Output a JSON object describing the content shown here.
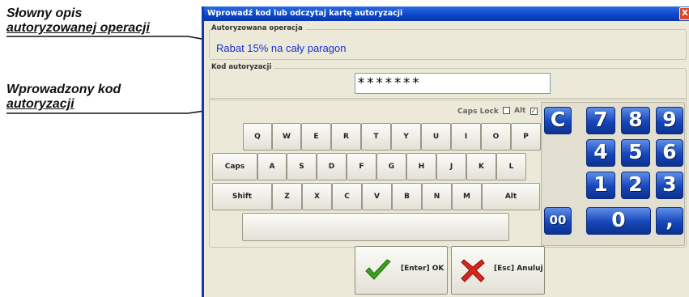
{
  "annotations": {
    "op_line1": "Słowny opis",
    "op_line2": "autoryzowanej operacji",
    "code_line1": "Wprowadzony kod",
    "code_line2": "autoryzacji"
  },
  "dialog": {
    "title": "Wprowadź kod lub odczytaj kartę autoryzacji",
    "close_glyph": "X",
    "operation_group_label": "Autoryzowana operacja",
    "operation_text": "Rabat 15% na cały paragon",
    "code_group_label": "Kod autoryzacji",
    "code_value": "*******",
    "caps_lock_label": "Caps Lock",
    "caps_lock_checked": false,
    "alt_label": "Alt",
    "alt_checked": true
  },
  "keyboard": {
    "row1": [
      "Q",
      "W",
      "E",
      "R",
      "T",
      "Y",
      "U",
      "I",
      "O",
      "P"
    ],
    "row2": [
      "Caps",
      "A",
      "S",
      "D",
      "F",
      "G",
      "H",
      "J",
      "K",
      "L"
    ],
    "row3": [
      "Shift",
      "Z",
      "X",
      "C",
      "V",
      "B",
      "N",
      "M",
      "Alt"
    ]
  },
  "numpad": {
    "clear": "C",
    "row1": [
      "7",
      "8",
      "9"
    ],
    "row2": [
      "4",
      "5",
      "6"
    ],
    "row3": [
      "1",
      "2",
      "3"
    ],
    "double_zero": "00",
    "zero": "0",
    "comma": ","
  },
  "buttons": {
    "ok_label": "[Enter] OK",
    "cancel_label": "[Esc] Anuluj"
  },
  "colors": {
    "title_bar": "#0a46c9",
    "operation_text": "#1a2fd0",
    "numpad_key": "#1646b9",
    "ok_icon": "#3aa31a",
    "cancel_icon": "#d9261c"
  }
}
